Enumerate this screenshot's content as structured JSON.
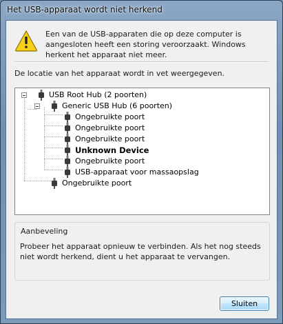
{
  "window": {
    "title": "Het USB-apparaat wordt niet herkend"
  },
  "message": {
    "text": "Een van de USB-apparaten die op deze computer is aangesloten heeft een storing veroorzaakt. Windows herkent het apparaat niet meer."
  },
  "location": {
    "text": "De locatie van het apparaat wordt in vet weergegeven."
  },
  "tree": {
    "root": "USB Root Hub (2 poorten)",
    "hub": "Generic USB Hub (6 poorten)",
    "ports": [
      "Ongebruikte poort",
      "Ongebruikte poort",
      "Ongebruikte poort",
      "Unknown Device",
      "Ongebruikte poort",
      "USB-apparaat voor massaopslag"
    ],
    "root_port": "Ongebruikte poort"
  },
  "recommendation": {
    "title": "Aanbeveling",
    "text": "Probeer het apparaat opnieuw te verbinden. Als het nog steeds niet wordt herkend, dient u het apparaat te vervangen."
  },
  "buttons": {
    "close": "Sluiten"
  },
  "icons": {
    "warning": "warning-icon",
    "device": "usb-plug-icon"
  },
  "colors": {
    "warning_fill": "#f7d117",
    "button_border": "#3c7fb1"
  }
}
